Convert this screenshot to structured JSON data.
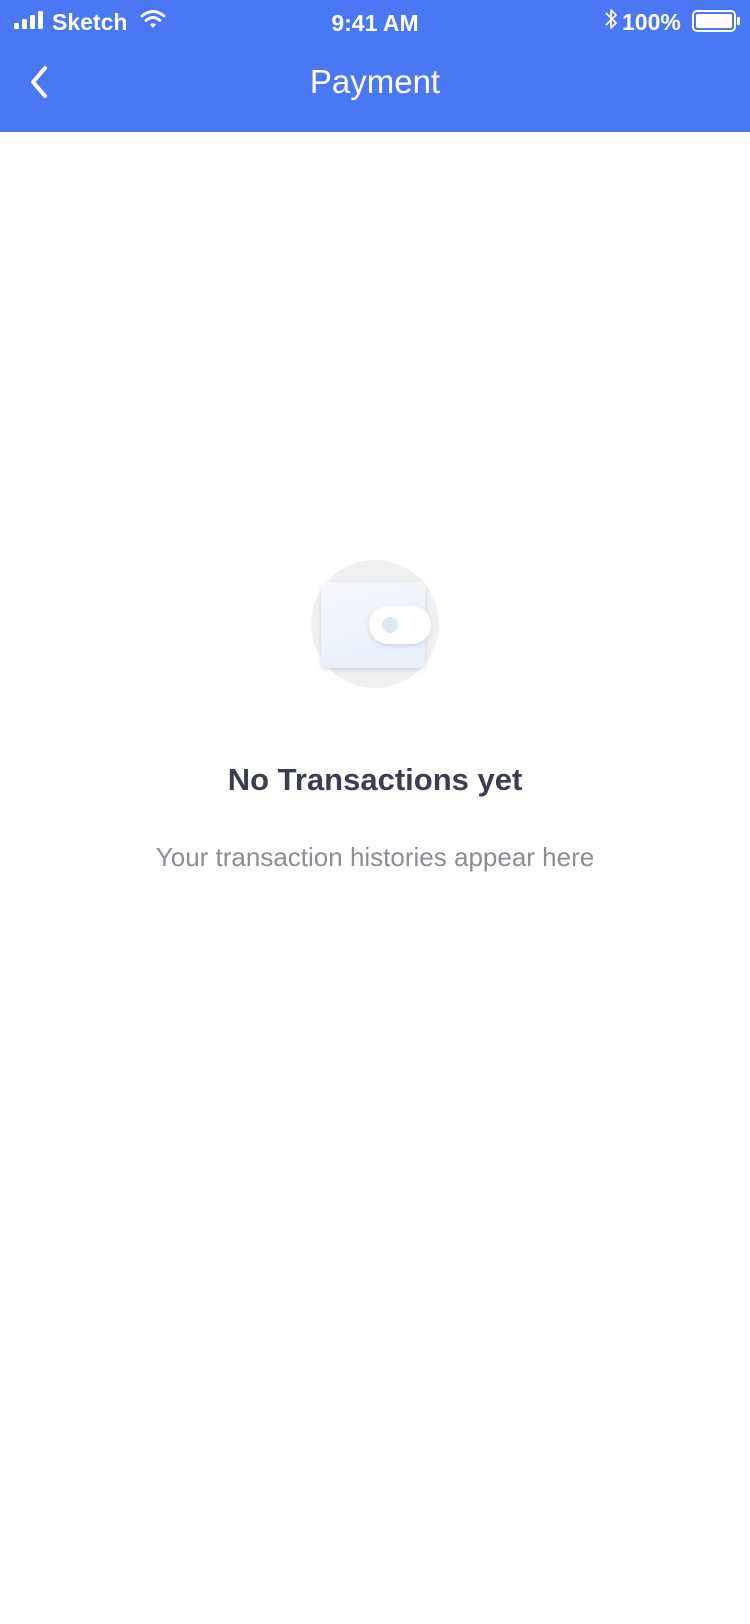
{
  "status_bar": {
    "carrier": "Sketch",
    "time": "9:41 AM",
    "battery_percent": "100%",
    "battery_level": 1.0,
    "icons": [
      "signal-icon",
      "wifi-icon",
      "bluetooth-icon",
      "battery-icon"
    ]
  },
  "nav": {
    "back_icon": "chevron-left-icon",
    "title": "Payment"
  },
  "empty_state": {
    "illustration_icon": "wallet-icon",
    "title": "No Transactions yet",
    "subtitle": "Your transaction histories appear here"
  },
  "colors": {
    "header_bg": "#4a77f3",
    "title_text": "#3b3e52",
    "subtitle_text": "#8b8d99",
    "illustration_circle": "#f0f0f2",
    "wallet_fill": "#eef3fb"
  }
}
